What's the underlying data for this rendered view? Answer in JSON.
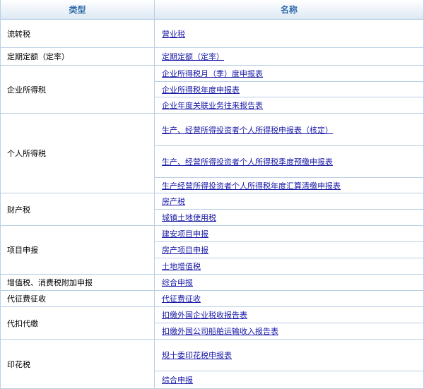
{
  "header": {
    "type_label": "类型",
    "name_label": "名称"
  },
  "rows": [
    {
      "category": "流转税",
      "items": [
        "营业税"
      ]
    },
    {
      "category": "定期定额（定率）",
      "items": [
        "定期定额（定率）"
      ]
    },
    {
      "category": "企业所得税",
      "items": [
        "企业所得税月（季）度申报表",
        "企业所得税年度申报表",
        "企业年度关联业务往来报告表"
      ]
    },
    {
      "category": "个人所得税",
      "items": [
        "生产、经营所得投资者个人所得税申报表（核定）",
        "生产、经营所得投资者个人所得税季度预缴申报表",
        "生产经营所得投资者个人所得税年度汇算清缴申报表"
      ]
    },
    {
      "category": "财产税",
      "items": [
        "房产税",
        "城镇土地使用税"
      ]
    },
    {
      "category": "项目申报",
      "items": [
        "建安项目申报",
        "房产项目申报",
        "土地增值税"
      ]
    },
    {
      "category": "增值税、消费税附加申报",
      "items": [
        "综合申报"
      ]
    },
    {
      "category": "代征费征收",
      "items": [
        "代征费征收"
      ]
    },
    {
      "category": "代扣代缴",
      "items": [
        "扣缴外国企业税收报告表",
        "扣缴外国公司船舶运输收入报告表"
      ]
    },
    {
      "category": "印花税",
      "items": [
        "规十委印花税申报表",
        "综合申报"
      ]
    }
  ]
}
